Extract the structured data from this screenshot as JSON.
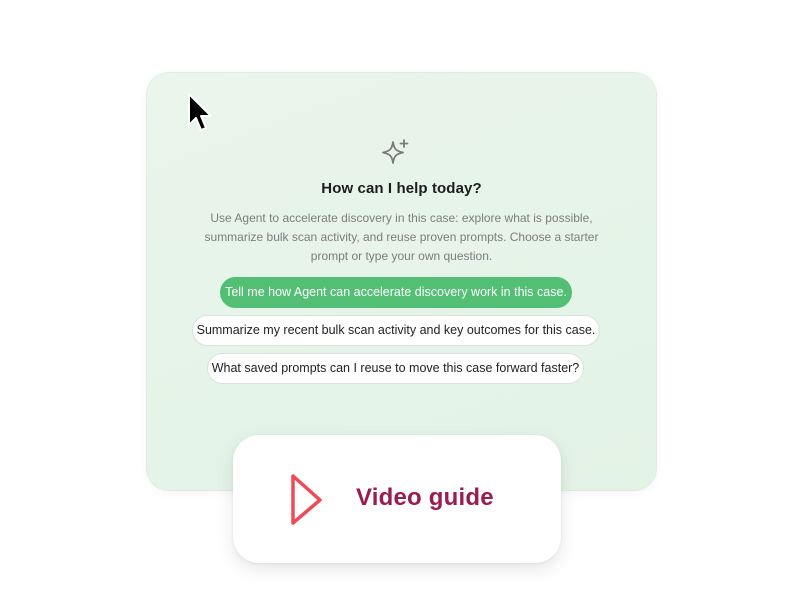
{
  "assistant": {
    "icon": "sparkle-icon",
    "title": "How can I help today?",
    "description": "Use Agent to accelerate discovery in this case: explore what is possible, summarize bulk scan activity, and reuse proven prompts. Choose a starter prompt or type your own question.",
    "prompts": [
      "Tell me how Agent can accelerate discovery work in this case.",
      "Summarize my recent bulk scan activity and key outcomes for this case.",
      "What saved prompts can I reuse to move this case forward faster?"
    ]
  },
  "video_guide": {
    "icon": "play-icon",
    "label": "Video guide"
  },
  "cursor": {
    "icon": "mouse-pointer-icon"
  },
  "colors": {
    "panel_background": "#e6f4e9",
    "primary_chip": "#52bf74",
    "video_label": "#9b1b52",
    "play_icon": "#ee4b57"
  }
}
